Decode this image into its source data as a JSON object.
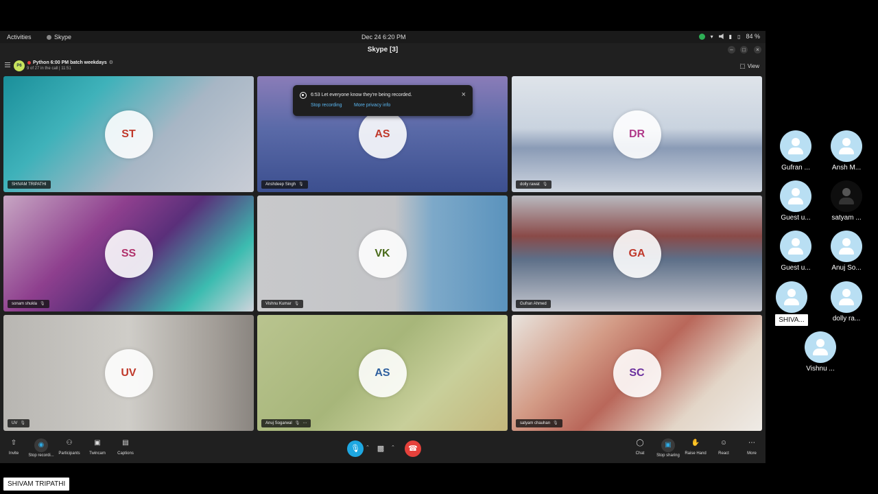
{
  "topbar": {
    "activities": "Activities",
    "app_name": "Skype",
    "clock": "Dec 24  6:20 PM",
    "battery": "84 %"
  },
  "window": {
    "title": "Skype [3]"
  },
  "call": {
    "group_initials": "P6",
    "group_name": "Python 6:00 PM batch weekdays",
    "subtitle": "9 of 27 in the call | 11:51",
    "view_label": "View"
  },
  "toast": {
    "message": "6:53 Let everyone know they're being recorded.",
    "stop_link": "Stop recording",
    "privacy_link": "More privacy info"
  },
  "tiles": [
    {
      "initials": "ST",
      "name": "SHIVAM TRIPATHI",
      "text_color": "#c0392b",
      "bg": "linear-gradient(135deg,#1a8f9a 0%,#3fb2ba 30%,#a7b6c5 60%,#c9cdd6 100%)",
      "muted": false
    },
    {
      "initials": "AS",
      "name": "Anshdeep Singh",
      "text_color": "#c0392b",
      "bg": "linear-gradient(180deg,#8a7cb8 0%,#5a6aa8 45%,#3c4f8f 100%)",
      "muted": true
    },
    {
      "initials": "DR",
      "name": "dolly rawat",
      "text_color": "#b03a8a",
      "bg": "linear-gradient(180deg,#dfe4ea 0%,#c9d3df 45%,#8a9bb6 62%,#cfd6e0 100%)",
      "muted": true
    },
    {
      "initials": "SS",
      "name": "sonam shukla",
      "text_color": "#b0306a",
      "bg": "linear-gradient(135deg,#c7a6c3 0%,#8e3f8e 35%,#5a2f7a 55%,#3cbcb0 80%,#d0d4dc 100%)",
      "muted": true
    },
    {
      "initials": "VK",
      "name": "Vishnu Kumar",
      "text_color": "#4a6b1a",
      "bg": "linear-gradient(90deg,#c8c9cb 0%,#c3c4c7 55%,#7da9c9 70%,#5b93bd 100%)",
      "muted": true
    },
    {
      "initials": "GA",
      "name": "Gufran Ahmed",
      "text_color": "#c0392b",
      "bg": "linear-gradient(180deg,#b9b9bf 0%,#8a4a48 35%,#5d6f88 55%,#c5c7cf 100%)",
      "muted": false
    },
    {
      "initials": "UV",
      "name": "UV",
      "text_color": "#c0392b",
      "bg": "linear-gradient(90deg,#b8b6b2 0%,#cfcdc8 50%,#a29d97 85%,#8a8580 100%)",
      "muted": true
    },
    {
      "initials": "AS",
      "name": "Anuj Sogarwal",
      "text_color": "#2e5f9e",
      "bg": "linear-gradient(135deg,#b9c48f 0%,#a7b67a 45%,#c8cf9a 70%,#c4b77c 100%)",
      "muted": true
    },
    {
      "initials": "SC",
      "name": "satyam chauhan",
      "text_color": "#6a2f9e",
      "bg": "linear-gradient(135deg,#e8e4de 0%,#d39b86 30%,#b9675a 50%,#e3d6c8 75%,#efebe6 100%)",
      "muted": true
    }
  ],
  "toolbar": {
    "invite": "Invite",
    "stop_recording": "Stop recordi...",
    "participants": "Participants",
    "twincam": "Twincam",
    "captions": "Captions",
    "chat": "Chat",
    "stop_sharing": "Stop sharing",
    "raise_hand": "Raise Hand",
    "react": "React",
    "more": "More"
  },
  "side_participants": [
    {
      "name": "Gufran ...",
      "photo": false
    },
    {
      "name": "Ansh M...",
      "photo": false
    },
    {
      "name": "Guest u...",
      "photo": false
    },
    {
      "name": "satyam ...",
      "photo": true
    },
    {
      "name": "Guest u...",
      "photo": false
    },
    {
      "name": "Anuj So...",
      "photo": false
    },
    {
      "name": "SHIVA...",
      "photo": false,
      "boxed": true
    },
    {
      "name": "dolly ra...",
      "photo": false
    },
    {
      "name": "Vishnu ...",
      "photo": false
    }
  ],
  "presenter_label": "SHIVAM TRIPATHI",
  "colors": {
    "accent": "#1ea7e1",
    "hangup": "#e5413b",
    "window_bg": "#202020"
  }
}
